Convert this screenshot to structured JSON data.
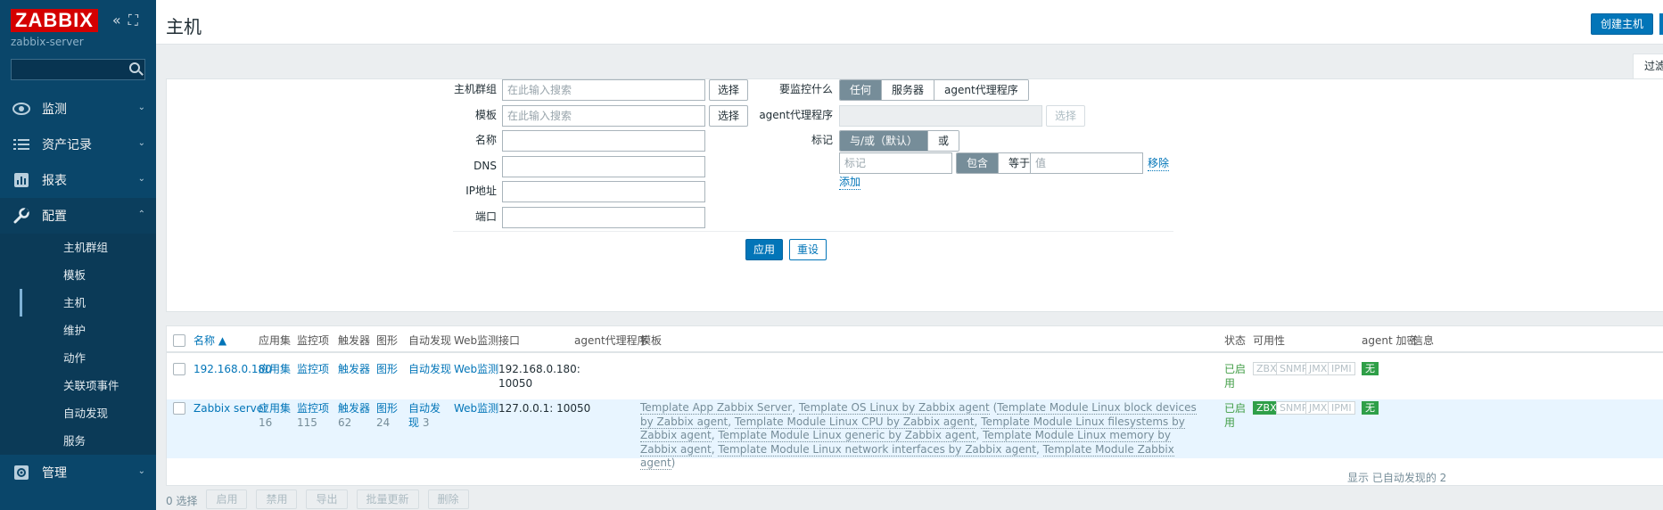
{
  "sidebar": {
    "logo": "ZABBIX",
    "server_name": "zabbix-server",
    "collapse_icon": "double-chevron-left-icon",
    "kiosk_icon": "kiosk-icon",
    "menu": [
      {
        "label": "监测",
        "icon": "eye-icon"
      },
      {
        "label": "资产记录",
        "icon": "list-icon"
      },
      {
        "label": "报表",
        "icon": "bar-chart-icon"
      },
      {
        "label": "配置",
        "icon": "wrench-icon"
      },
      {
        "label": "管理",
        "icon": "gear-icon"
      }
    ],
    "submenu": [
      "主机群组",
      "模板",
      "主机",
      "维护",
      "动作",
      "关联项事件",
      "自动发现",
      "服务"
    ]
  },
  "header": {
    "title": "主机",
    "create_button": "创建主机"
  },
  "filter": {
    "tab_label": "过滤器",
    "host_group_label": "主机群组",
    "host_group_placeholder": "在此输入搜索",
    "template_label": "模板",
    "template_placeholder": "在此输入搜索",
    "select_button": "选择",
    "name_label": "名称",
    "dns_label": "DNS",
    "ip_label": "IP地址",
    "port_label": "端口",
    "monitored_by_label": "要监控什么",
    "monitored_by_options": [
      "任何",
      "服务器",
      "agent代理程序"
    ],
    "proxy_label": "agent代理程序",
    "tags_label": "标记",
    "tags_mode_options": [
      "与/或（默认）",
      "或"
    ],
    "tag_placeholder": "标记",
    "tag_operator_options": [
      "包含",
      "等于"
    ],
    "value_placeholder": "值",
    "remove_link": "移除",
    "add_link": "添加",
    "apply_button": "应用",
    "reset_button": "重设"
  },
  "table": {
    "columns": [
      "名称 ▲",
      "应用集",
      "监控项",
      "触发器",
      "图形",
      "自动发现",
      "Web监测",
      "接口",
      "agent代理程序",
      "模板",
      "状态",
      "可用性",
      "agent 加密",
      "信息"
    ],
    "rows": [
      {
        "name": "192.168.0.180",
        "applications": "应用集",
        "items": "监控项",
        "triggers": "触发器",
        "graphs": "图形",
        "discovery": "自动发现",
        "web": "Web监测",
        "interface": "192.168.0.180: 10050",
        "templates": "",
        "status": "已启用",
        "availability": [
          "ZBX",
          "SNMP",
          "JMX",
          "IPMI"
        ],
        "encryption": "无"
      },
      {
        "name": "Zabbix server",
        "applications": "应用集",
        "applications_count": "16",
        "items": "监控项",
        "items_count": "115",
        "triggers": "触发器",
        "triggers_count": "62",
        "graphs": "图形",
        "graphs_count": "24",
        "discovery": "自动发现",
        "discovery_count": "3",
        "web": "Web监测",
        "interface": "127.0.0.1: 10050",
        "templates": {
          "t1": "Template App Zabbix Server",
          "t2": "Template OS Linux by Zabbix agent",
          "t3": "Template Module Linux block devices by Zabbix agent",
          "t4": "Template Module Linux CPU by Zabbix agent",
          "t5": "Template Module Linux filesystems by Zabbix agent",
          "t6": "Template Module Linux generic by Zabbix agent",
          "t7": "Template Module Linux memory by Zabbix agent",
          "t8": "Template Module Linux network interfaces by Zabbix agent",
          "t9": "Template Module Zabbix agent"
        },
        "status": "已启用",
        "availability": [
          "ZBX",
          "SNMP",
          "JMX",
          "IPMI"
        ],
        "encryption": "无"
      }
    ],
    "footer_note": "显示 已自动发现的 2",
    "selected_count": "0 选择",
    "mass_buttons": [
      "启用",
      "禁用",
      "导出",
      "批量更新",
      "删除"
    ]
  },
  "colors": {
    "sidebar_bg": "#0a466a",
    "accent": "#0275b8",
    "logo_red": "#d40000",
    "status_green": "#429e47",
    "badge_green": "#2f9f48"
  }
}
